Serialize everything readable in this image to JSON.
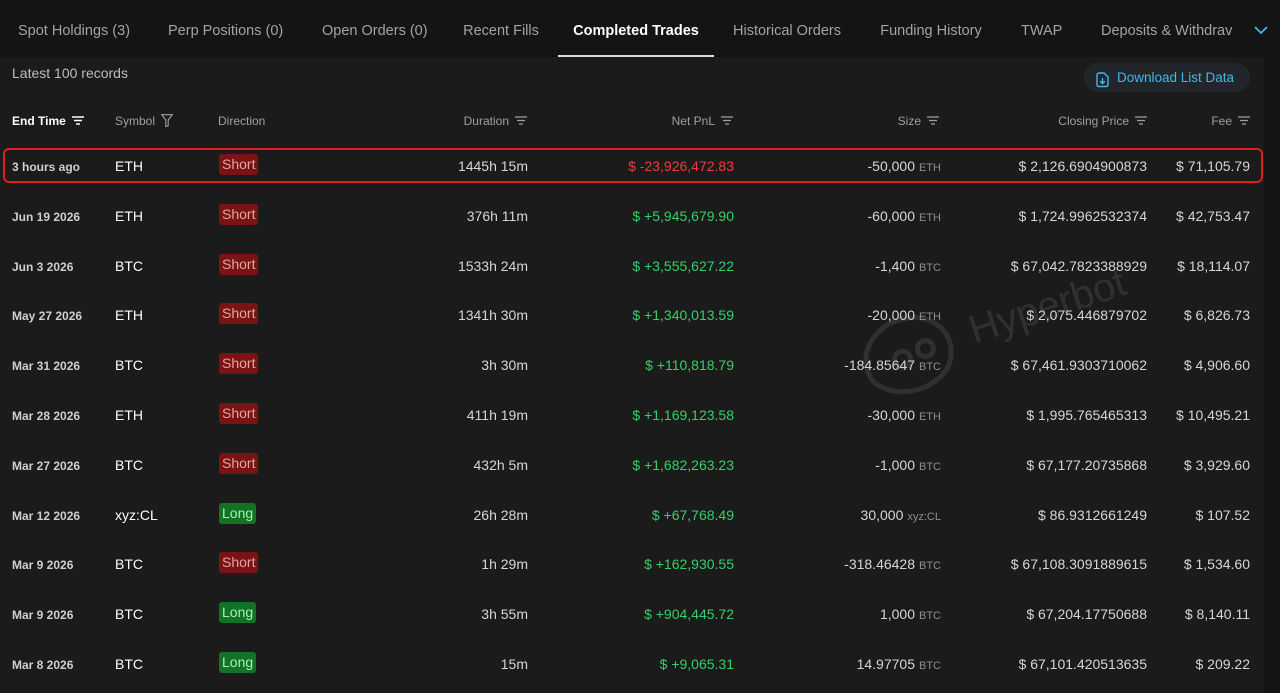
{
  "tabs": [
    {
      "label": "Spot Holdings (3)",
      "active": false
    },
    {
      "label": "Perp Positions (0)",
      "active": false
    },
    {
      "label": "Open Orders (0)",
      "active": false
    },
    {
      "label": "Recent Fills",
      "active": false
    },
    {
      "label": "Completed Trades",
      "active": true
    },
    {
      "label": "Historical Orders",
      "active": false
    },
    {
      "label": "Funding History",
      "active": false
    },
    {
      "label": "TWAP",
      "active": false
    },
    {
      "label": "Deposits & Withdrav",
      "active": false
    }
  ],
  "header": {
    "records_label": "Latest 100 records",
    "download_label": "Download List Data"
  },
  "columns": {
    "end_time": "End Time",
    "symbol": "Symbol",
    "direction": "Direction",
    "duration": "Duration",
    "net_pnl": "Net PnL",
    "size": "Size",
    "closing_price": "Closing Price",
    "fee": "Fee"
  },
  "watermark": "Hyperbot",
  "colors": {
    "short_bg": "#7a1313",
    "long_bg": "#127225",
    "pnl_negative": "#f23b3b",
    "pnl_positive": "#35d068",
    "accent": "#3fb9e6",
    "highlight_border": "#e02020"
  },
  "rows": [
    {
      "time": "3 hours ago",
      "symbol": "ETH",
      "direction": "Short",
      "duration": "1445h 15m",
      "pnl": "$ -23,926,472.83",
      "size": "-50,000",
      "unit": "ETH",
      "close": "$ 2,126.6904900873",
      "fee": "$ 71,105.79",
      "highlighted": true
    },
    {
      "time": "Jun 19 2026",
      "symbol": "ETH",
      "direction": "Short",
      "duration": "376h 11m",
      "pnl": "$ +5,945,679.90",
      "size": "-60,000",
      "unit": "ETH",
      "close": "$ 1,724.9962532374",
      "fee": "$ 42,753.47"
    },
    {
      "time": "Jun 3 2026",
      "symbol": "BTC",
      "direction": "Short",
      "duration": "1533h 24m",
      "pnl": "$ +3,555,627.22",
      "size": "-1,400",
      "unit": "BTC",
      "close": "$ 67,042.7823388929",
      "fee": "$ 18,114.07"
    },
    {
      "time": "May 27 2026",
      "symbol": "ETH",
      "direction": "Short",
      "duration": "1341h 30m",
      "pnl": "$ +1,340,013.59",
      "size": "-20,000",
      "unit": "ETH",
      "close": "$ 2,075.446879702",
      "fee": "$ 6,826.73"
    },
    {
      "time": "Mar 31 2026",
      "symbol": "BTC",
      "direction": "Short",
      "duration": "3h 30m",
      "pnl": "$ +110,818.79",
      "size": "-184.85647",
      "unit": "BTC",
      "close": "$ 67,461.9303710062",
      "fee": "$ 4,906.60"
    },
    {
      "time": "Mar 28 2026",
      "symbol": "ETH",
      "direction": "Short",
      "duration": "411h 19m",
      "pnl": "$ +1,169,123.58",
      "size": "-30,000",
      "unit": "ETH",
      "close": "$ 1,995.765465313",
      "fee": "$ 10,495.21"
    },
    {
      "time": "Mar 27 2026",
      "symbol": "BTC",
      "direction": "Short",
      "duration": "432h 5m",
      "pnl": "$ +1,682,263.23",
      "size": "-1,000",
      "unit": "BTC",
      "close": "$ 67,177.20735868",
      "fee": "$ 3,929.60"
    },
    {
      "time": "Mar 12 2026",
      "symbol": "xyz:CL",
      "direction": "Long",
      "duration": "26h 28m",
      "pnl": "$ +67,768.49",
      "size": "30,000",
      "unit": "xyz:CL",
      "close": "$ 86.9312661249",
      "fee": "$ 107.52"
    },
    {
      "time": "Mar 9 2026",
      "symbol": "BTC",
      "direction": "Short",
      "duration": "1h 29m",
      "pnl": "$ +162,930.55",
      "size": "-318.46428",
      "unit": "BTC",
      "close": "$ 67,108.3091889615",
      "fee": "$ 1,534.60"
    },
    {
      "time": "Mar 9 2026",
      "symbol": "BTC",
      "direction": "Long",
      "duration": "3h 55m",
      "pnl": "$ +904,445.72",
      "size": "1,000",
      "unit": "BTC",
      "close": "$ 67,204.17750688",
      "fee": "$ 8,140.11"
    },
    {
      "time": "Mar 8 2026",
      "symbol": "BTC",
      "direction": "Long",
      "duration": "15m",
      "pnl": "$ +9,065.31",
      "size": "14.97705",
      "unit": "BTC",
      "close": "$ 67,101.420513635",
      "fee": "$ 209.22"
    }
  ]
}
